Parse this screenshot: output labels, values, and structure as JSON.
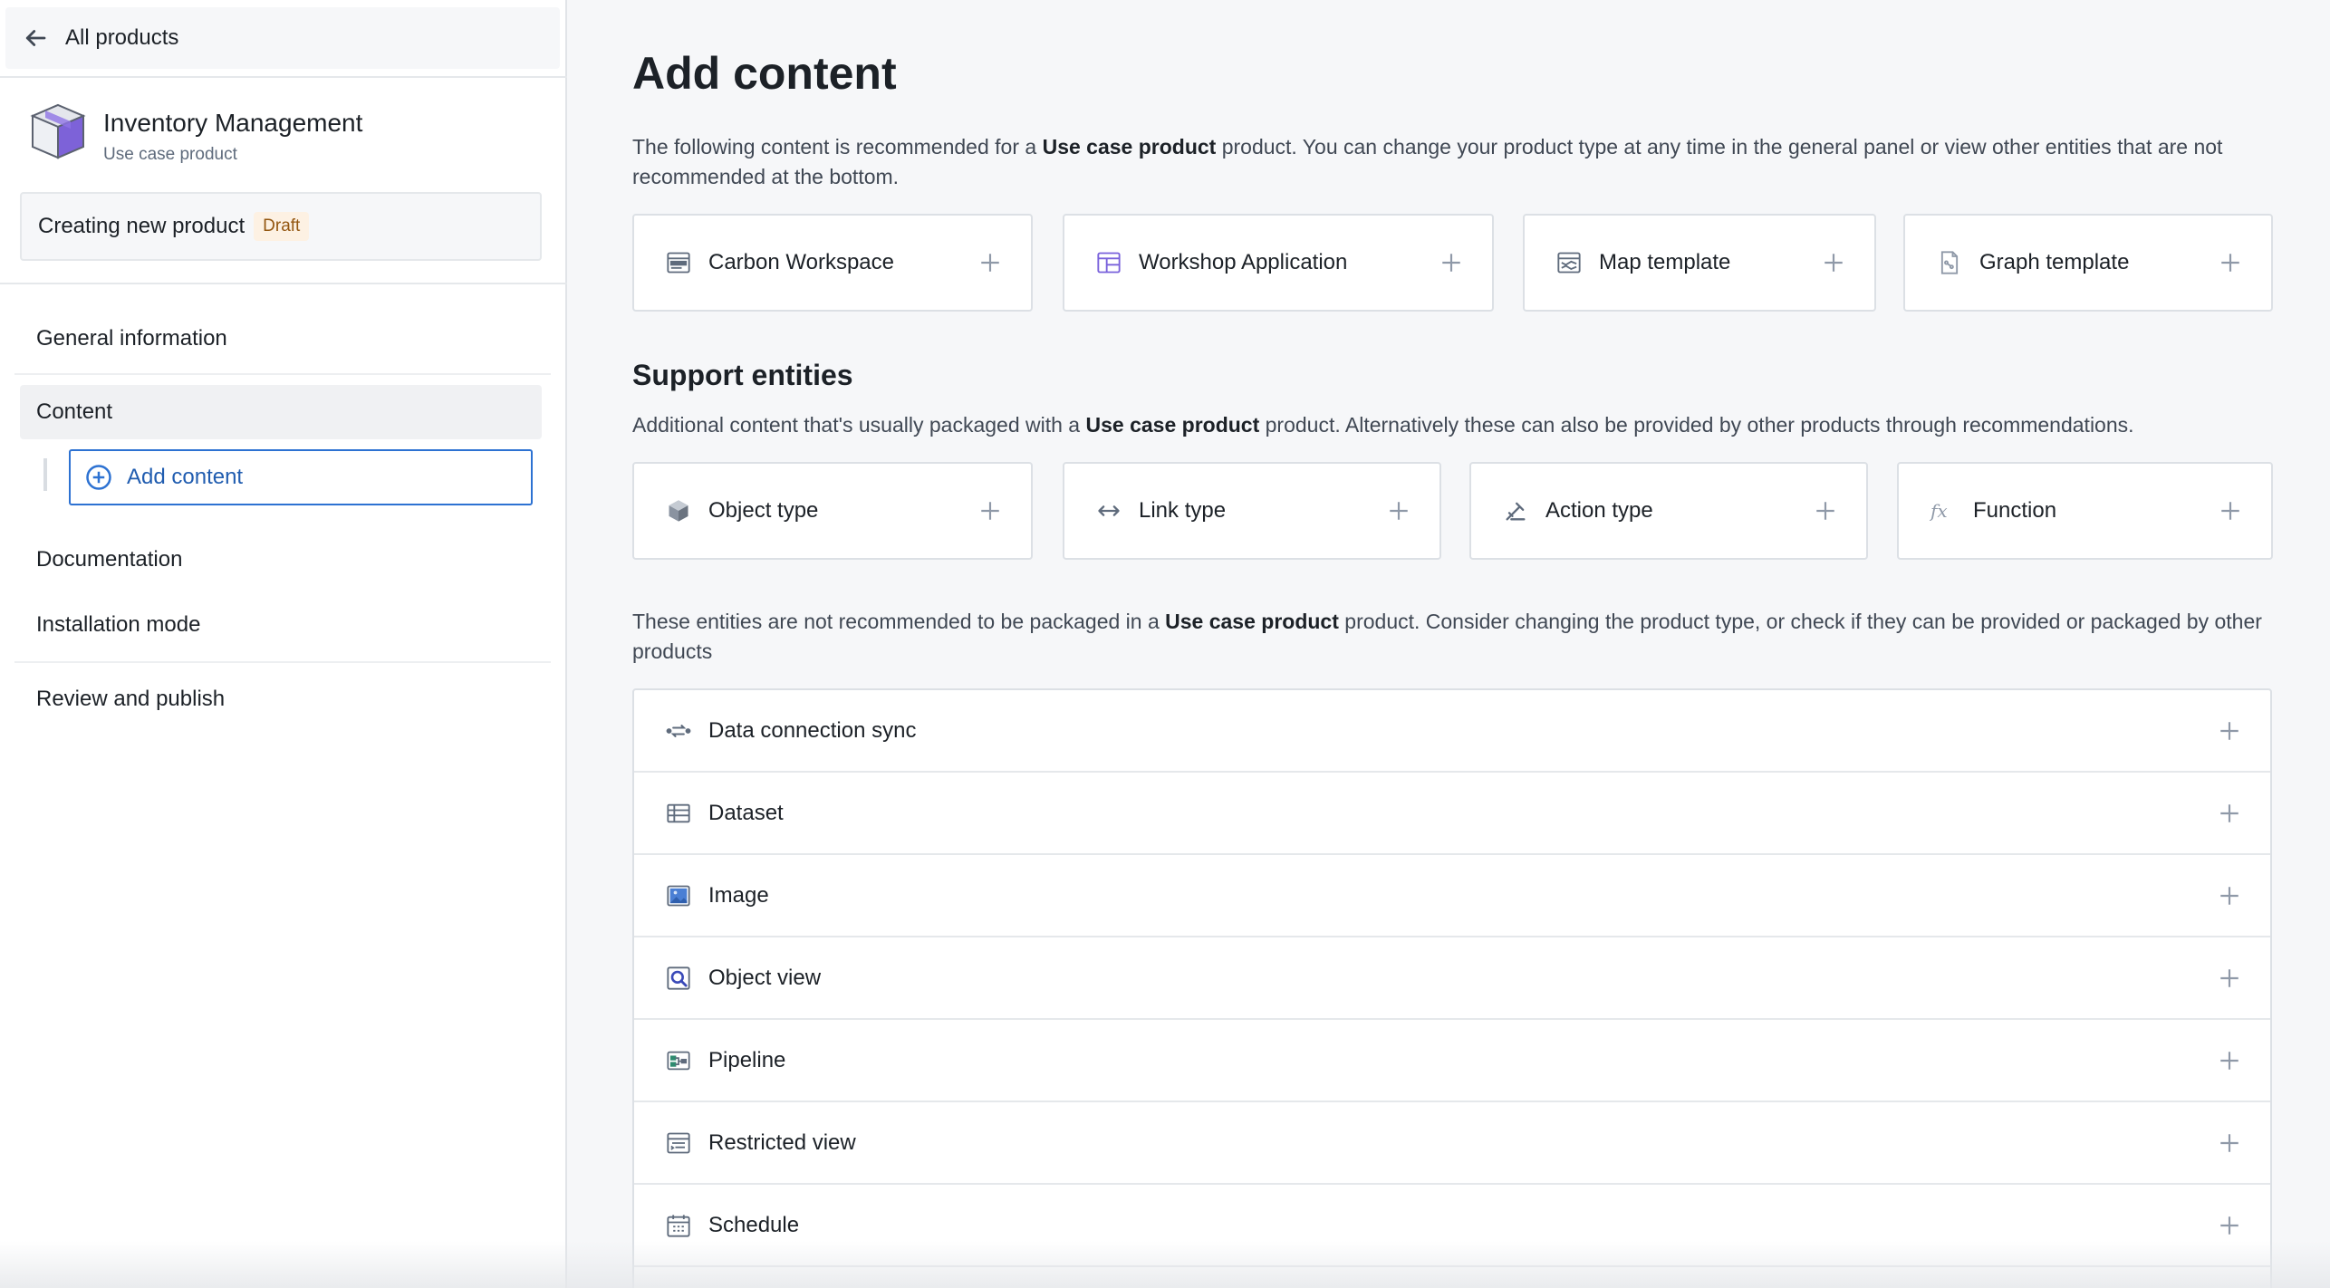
{
  "sidebar": {
    "back_label": "All products",
    "product_name": "Inventory Management",
    "product_type": "Use case product",
    "status_label": "Creating new product",
    "draft_tag": "Draft",
    "nav": {
      "general": "General information",
      "content": "Content",
      "add_content": "Add content",
      "documentation": "Documentation",
      "installation": "Installation mode",
      "review": "Review and publish"
    }
  },
  "main": {
    "title": "Add content",
    "intro": {
      "pre": "The following content is recommended for a ",
      "bold": "Use case product",
      "post": " product. You can change your product type at any time in the general panel or view other entities that are not recommended at the bottom."
    },
    "recommended": [
      {
        "label": "Carbon Workspace",
        "icon": "carbon-workspace-icon"
      },
      {
        "label": "Workshop Application",
        "icon": "workshop-app-icon"
      },
      {
        "label": "Map template",
        "icon": "map-template-icon"
      },
      {
        "label": "Graph template",
        "icon": "graph-template-icon"
      }
    ],
    "support_title": "Support entities",
    "support_desc": {
      "pre": "Additional content that's usually packaged with a ",
      "bold": "Use case product",
      "post": " product. Alternatively these can also be provided by other products through recommendations."
    },
    "support": [
      {
        "label": "Object type",
        "icon": "cube-icon"
      },
      {
        "label": "Link type",
        "icon": "link-arrows-icon"
      },
      {
        "label": "Action type",
        "icon": "action-icon"
      },
      {
        "label": "Function",
        "icon": "function-icon"
      }
    ],
    "not_rec_desc": {
      "pre": "These entities are not recommended to be packaged in a ",
      "bold": "Use case product",
      "post": " product. Consider changing the product type, or check if they can be provided or packaged by other products"
    },
    "not_recommended": [
      {
        "label": "Data connection sync",
        "icon": "sync-icon"
      },
      {
        "label": "Dataset",
        "icon": "dataset-icon"
      },
      {
        "label": "Image",
        "icon": "image-icon"
      },
      {
        "label": "Object view",
        "icon": "object-view-icon"
      },
      {
        "label": "Pipeline",
        "icon": "pipeline-icon"
      },
      {
        "label": "Restricted view",
        "icon": "restricted-view-icon"
      },
      {
        "label": "Schedule",
        "icon": "calendar-icon"
      }
    ]
  },
  "colors": {
    "accent": "#2d72d2",
    "draft_bg": "#fdf1e3",
    "draft_text": "#935610"
  }
}
